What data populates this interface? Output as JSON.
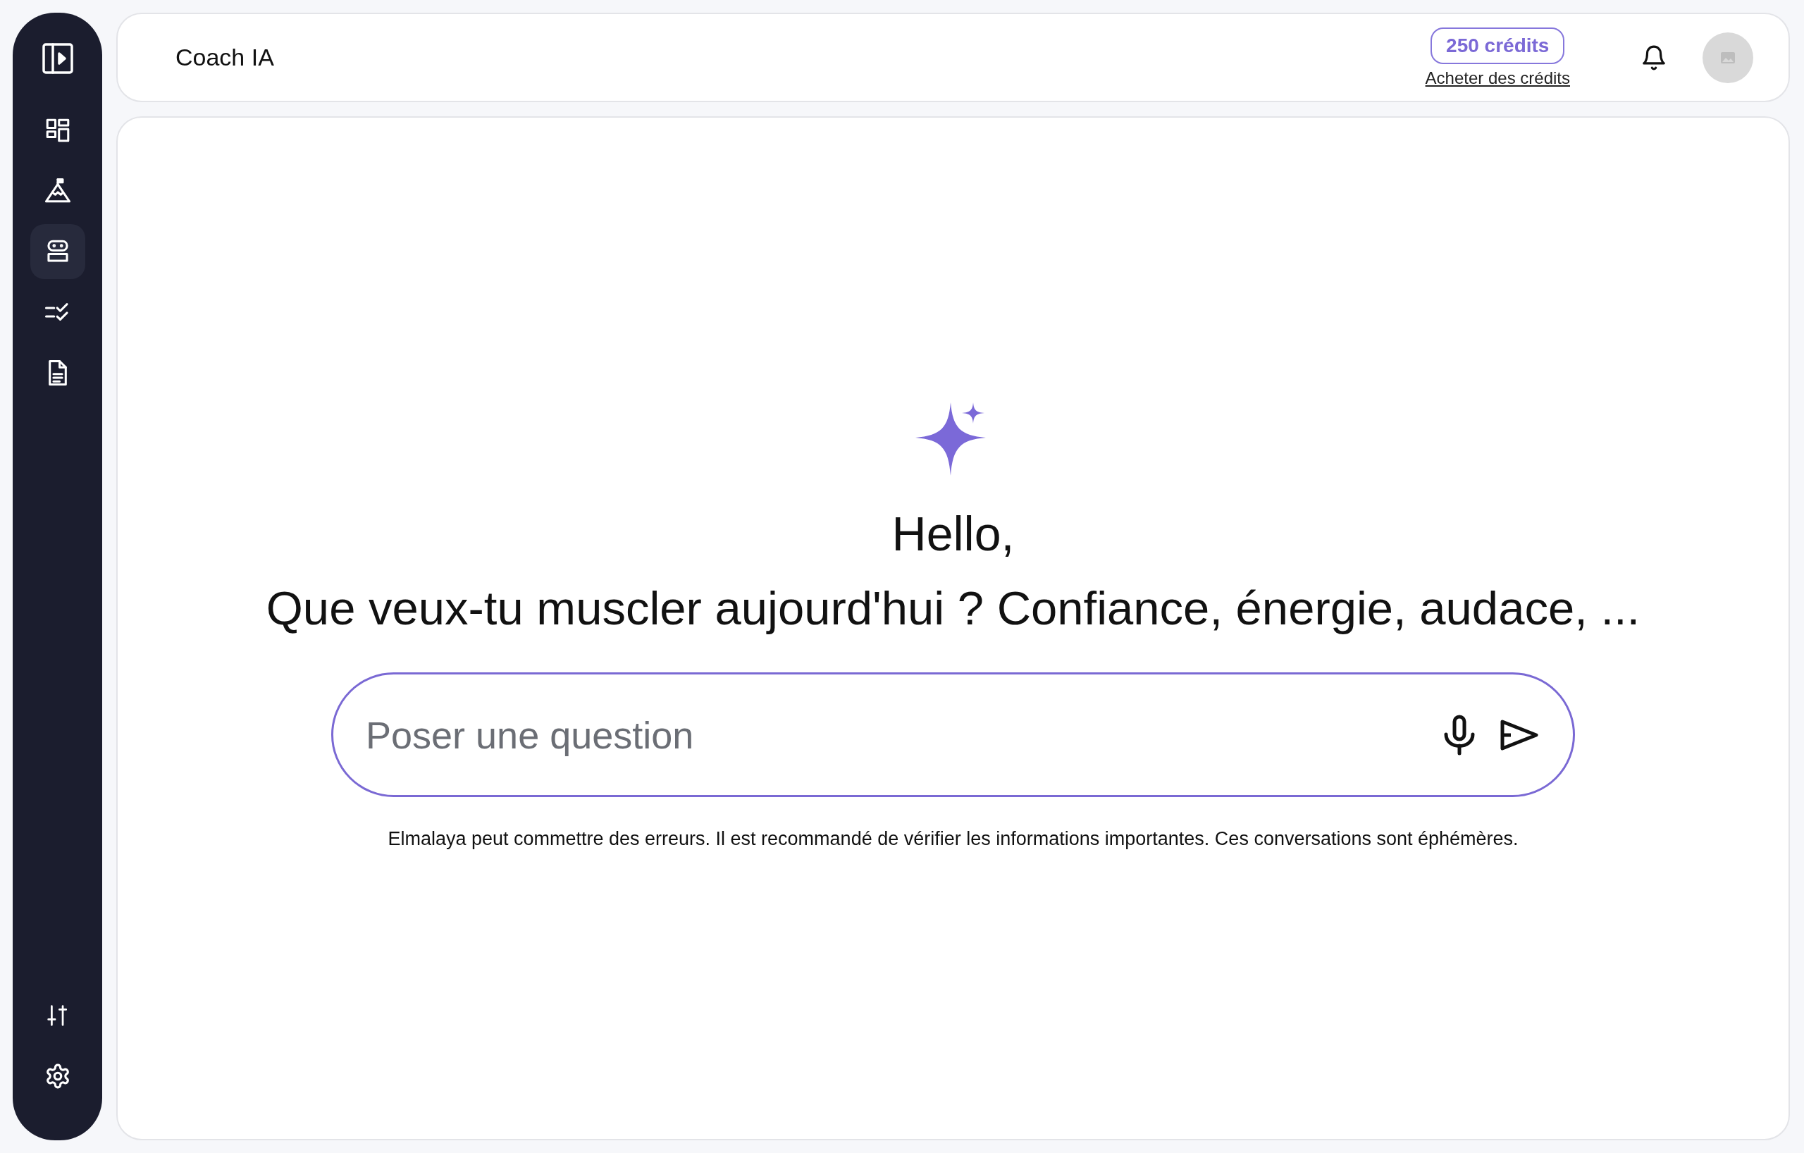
{
  "sidebar": {
    "items": [
      {
        "selected": false
      },
      {
        "selected": false
      },
      {
        "selected": true
      },
      {
        "selected": false
      },
      {
        "selected": false
      }
    ]
  },
  "header": {
    "title": "Coach IA",
    "credits": "250 crédits",
    "buy_link": "Acheter des crédits"
  },
  "chat": {
    "greeting": "Hello,",
    "prompt": "Que veux-tu muscler aujourd'hui ? Confiance, énergie, audace, ...",
    "input": {
      "placeholder": "Poser une question"
    },
    "disclaimer": "Elmalaya peut commettre des erreurs. Il est recommandé de vérifier les informations importantes. Ces conversations sont éphémères."
  }
}
